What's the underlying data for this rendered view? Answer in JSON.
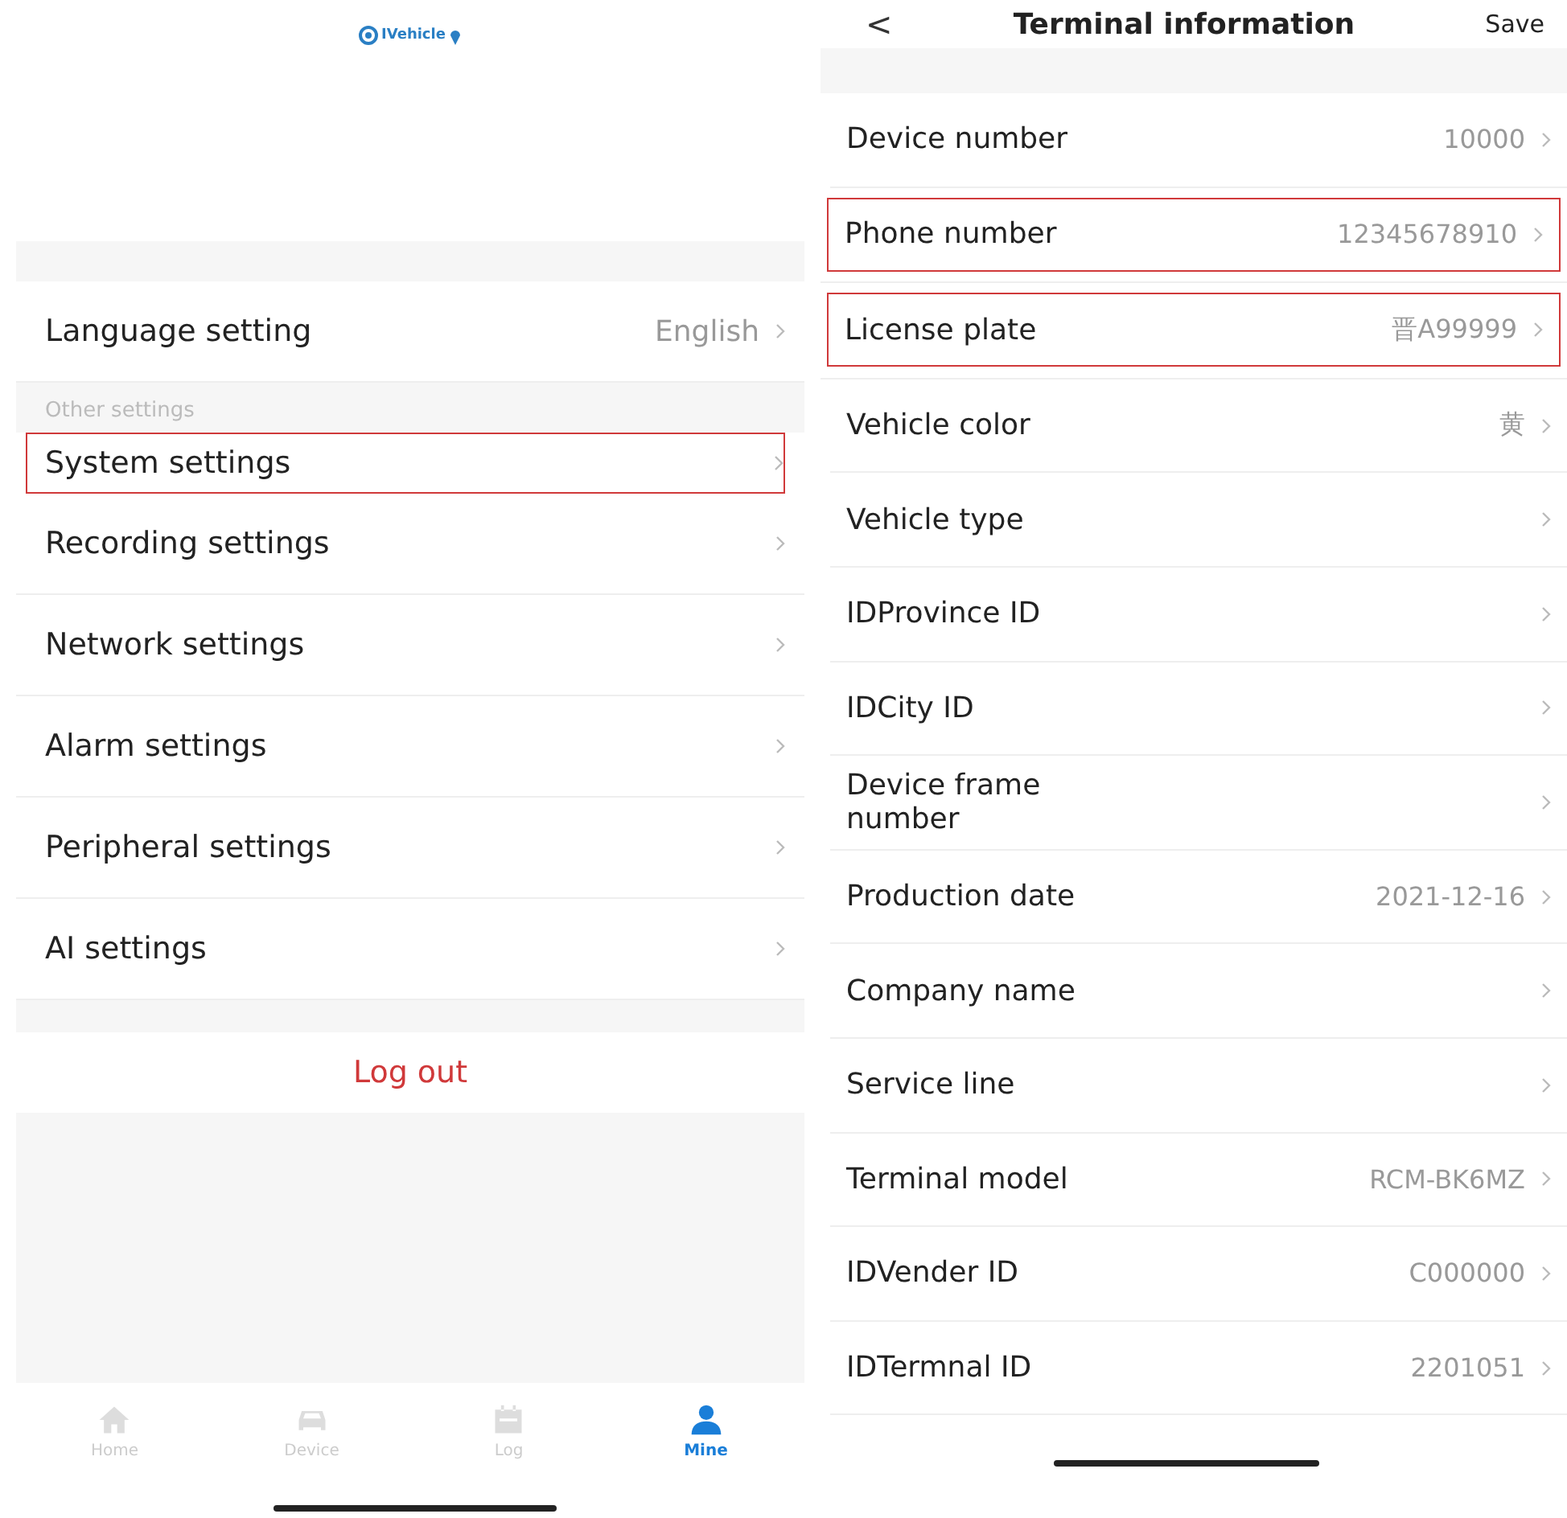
{
  "left_screen": {
    "logo": {
      "text": "IVehicle"
    },
    "language_row": {
      "label": "Language setting",
      "value": "English",
      "highlighted": false
    },
    "section_title": "Other settings",
    "settings": [
      {
        "label": "System settings",
        "highlighted": true
      },
      {
        "label": "Recording settings",
        "highlighted": false
      },
      {
        "label": "Network settings",
        "highlighted": false
      },
      {
        "label": "Alarm settings",
        "highlighted": false
      },
      {
        "label": "Peripheral settings",
        "highlighted": false
      },
      {
        "label": "AI settings",
        "highlighted": false
      }
    ],
    "logout_button": "Log out",
    "tab_bar": [
      {
        "label": "Home",
        "selected": false
      },
      {
        "label": "Device",
        "selected": false
      },
      {
        "label": "Log",
        "selected": false
      },
      {
        "label": "Mine",
        "selected": true
      }
    ]
  },
  "right_screen": {
    "header": {
      "back": "<",
      "title": "Terminal information",
      "action": "Save"
    },
    "fields": [
      {
        "label": "Device number",
        "value": "10000",
        "highlighted": false
      },
      {
        "label": "Phone number",
        "value": "12345678910",
        "highlighted": true
      },
      {
        "label": "License plate",
        "value": "晋A99999",
        "highlighted": true
      },
      {
        "label": "Vehicle color",
        "value": "黄",
        "highlighted": false
      },
      {
        "label": "Vehicle type",
        "highlighted": false
      },
      {
        "label": "IDProvince ID",
        "highlighted": false
      },
      {
        "label": "IDCity ID",
        "highlighted": false
      },
      {
        "label": "Device frame number",
        "highlighted": false
      },
      {
        "label": "Production date",
        "value": "2021-12-16",
        "highlighted": false
      },
      {
        "label": "Company name",
        "highlighted": false
      },
      {
        "label": "Service line",
        "highlighted": false
      },
      {
        "label": "Terminal model",
        "value": "RCM-BK6MZ",
        "highlighted": false
      },
      {
        "label": "IDVender ID",
        "value": "C000000",
        "highlighted": false
      },
      {
        "label": "IDTermnal ID",
        "value": "2201051",
        "highlighted": false
      }
    ]
  }
}
